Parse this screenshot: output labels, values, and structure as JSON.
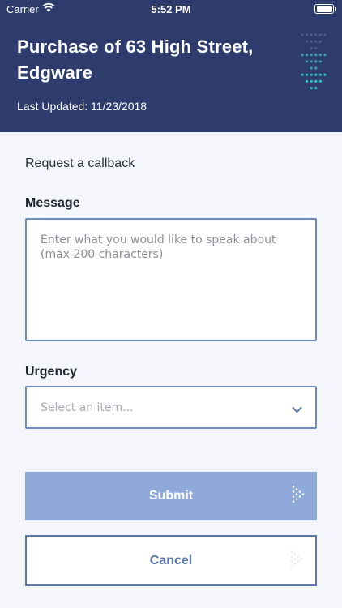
{
  "status_bar": {
    "carrier": "Carrier",
    "time": "5:52 PM"
  },
  "header": {
    "title": "Purchase of 63 High Street, Edgware",
    "last_updated": "Last Updated: 11/23/2018"
  },
  "form": {
    "section_title": "Request a callback",
    "message_label": "Message",
    "message_placeholder": "Enter what you would like to speak about (max 200 characters)",
    "message_value": "",
    "urgency_label": "Urgency",
    "urgency_placeholder": "Select an item..."
  },
  "buttons": {
    "submit_label": "Submit",
    "cancel_label": "Cancel"
  },
  "icons": {
    "wifi": "wifi-icon",
    "battery": "battery-icon",
    "logo": "brand-logo",
    "chevron": "chevron-down-icon",
    "arrow": "arrow-right-icon"
  },
  "colors": {
    "header_bg": "#2d3b6d",
    "accent": "#6e8bbd",
    "submit_bg": "#8fa9db",
    "logo_teal": "#2ec4c4"
  }
}
